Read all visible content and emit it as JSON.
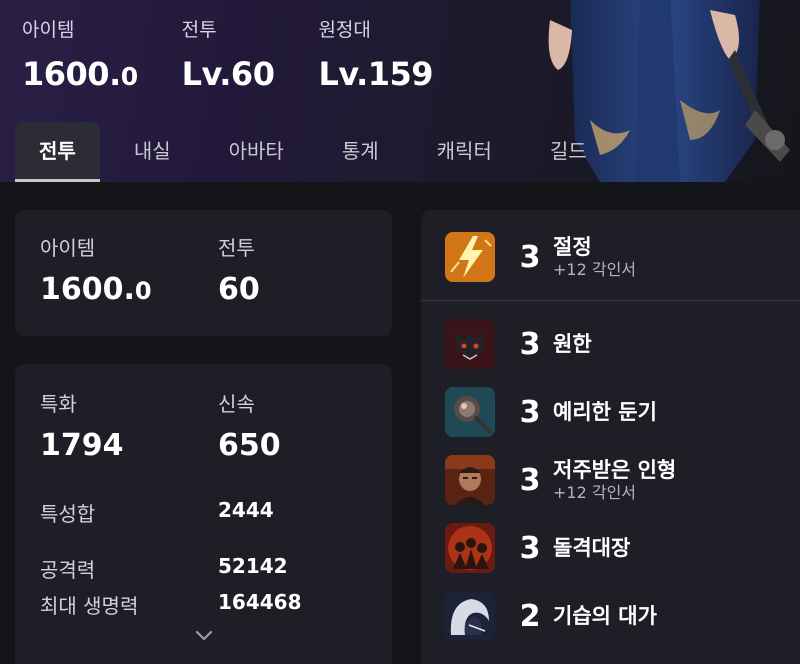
{
  "header": {
    "stats": [
      {
        "label": "아이템",
        "value": "1600.",
        "decimal": "0"
      },
      {
        "label": "전투",
        "value": "Lv.60",
        "decimal": ""
      },
      {
        "label": "원정대",
        "value": "Lv.159",
        "decimal": ""
      }
    ]
  },
  "tabs": [
    "전투",
    "내실",
    "아바타",
    "통계",
    "캐릭터",
    "길드"
  ],
  "summary": {
    "item_label": "아이템",
    "item_value": "1600.",
    "item_decimal": "0",
    "combat_label": "전투",
    "combat_value": "60"
  },
  "stats": {
    "specialization_label": "특화",
    "specialization_value": "1794",
    "swiftness_label": "신속",
    "swiftness_value": "650",
    "trait_total_label": "특성합",
    "trait_total_value": "2444",
    "attack_label": "공격력",
    "attack_value": "52142",
    "max_hp_label": "최대 생명력",
    "max_hp_value": "164468"
  },
  "engravings": [
    {
      "level": "3",
      "name": "절정",
      "sub": "+12 각인서",
      "icon": "lightning-icon"
    },
    {
      "level": "3",
      "name": "원한",
      "sub": "",
      "icon": "beast-icon"
    },
    {
      "level": "3",
      "name": "예리한 둔기",
      "sub": "",
      "icon": "mace-icon"
    },
    {
      "level": "3",
      "name": "저주받은 인형",
      "sub": "+12 각인서",
      "icon": "doll-icon"
    },
    {
      "level": "3",
      "name": "돌격대장",
      "sub": "",
      "icon": "charge-icon"
    },
    {
      "level": "2",
      "name": "기습의 대가",
      "sub": "",
      "icon": "ambush-icon"
    }
  ],
  "colors": {
    "background": "#141519",
    "card": "#1e1f26",
    "hero_purple": "#2a1f45"
  }
}
